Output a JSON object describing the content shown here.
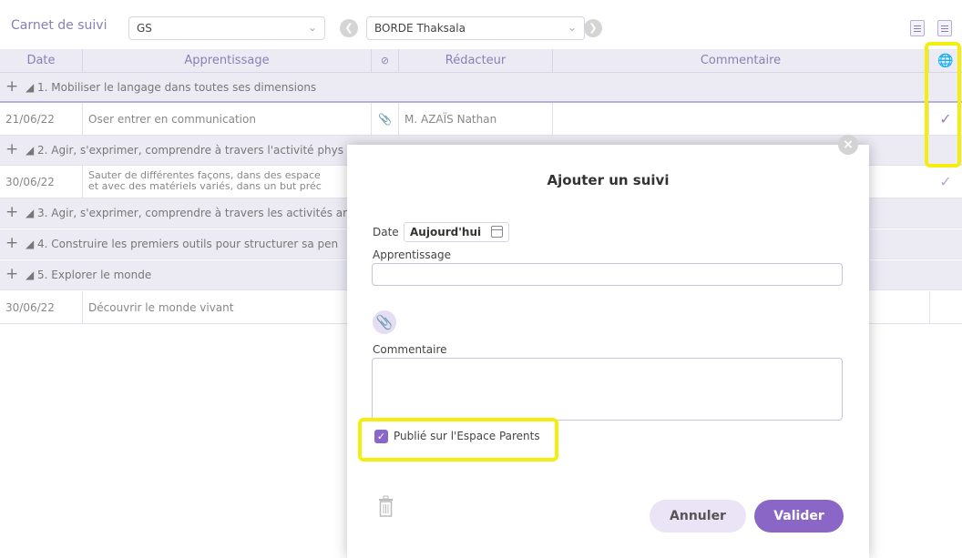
{
  "toolbar": {
    "title": "Carnet de suivi",
    "class_select": "GS",
    "student_select": "BORDE Thaksala",
    "prev_glyph": "❮",
    "next_glyph": "❯"
  },
  "table": {
    "headers": {
      "date": "Date",
      "apprentissage": "Apprentissage",
      "redacteur": "Rédacteur",
      "commentaire": "Commentaire"
    },
    "groups": [
      "+",
      "◢ 1. Mobiliser le langage dans toutes ses dimensions",
      "◢ 2. Agir, s'exprimer, comprendre à travers l'activité phys",
      "◢ 3. Agir, s'exprimer, comprendre à travers les activités ar",
      "◢ 4. Construire les premiers outils pour structurer sa pen",
      "◢ 5. Explorer le monde"
    ],
    "rows": [
      {
        "date": "21/06/22",
        "apprentissage": "Oser entrer en communication",
        "attach": "📎",
        "redacteur": "M. AZAÏS Nathan",
        "published": "✓"
      },
      {
        "date": "30/06/22",
        "apprentissage_line1": "Sauter de différentes façons, dans des espace",
        "apprentissage_line2": "et avec des matériels variés, dans un but préc",
        "published": "✓"
      },
      {
        "date": "30/06/22",
        "apprentissage": "Découvrir le monde vivant"
      }
    ],
    "globe_glyph": "🌐"
  },
  "modal": {
    "title": "Ajouter un suivi",
    "close_glyph": "×",
    "date_label": "Date",
    "date_value": "Aujourd'hui",
    "apprentissage_label": "Apprentissage",
    "clip_glyph": "📎",
    "commentaire_label": "Commentaire",
    "publish_check": "✓",
    "publish_label": "Publié sur l'Espace Parents",
    "cancel_label": "Annuler",
    "ok_label": "Valider"
  },
  "colors": {
    "accent": "#8a67c6",
    "highlight": "#f4ee0c",
    "group_bg": "#ecebf4"
  }
}
